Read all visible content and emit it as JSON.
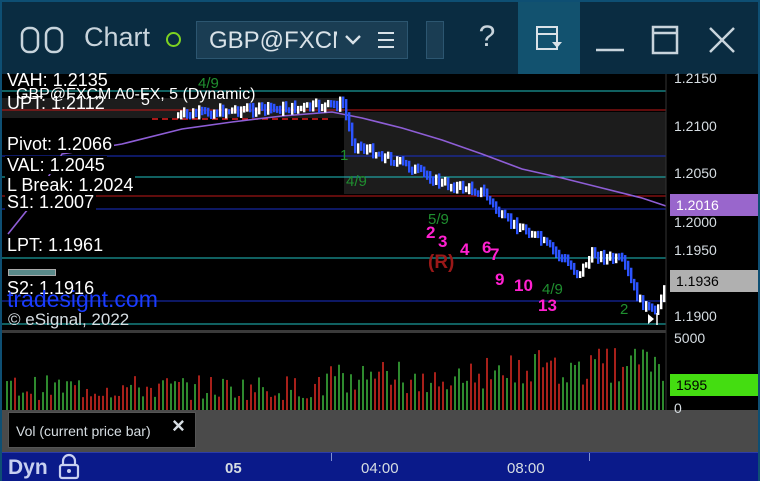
{
  "titlebar": {
    "title": "Chart",
    "symbol": "GBP@FXCM",
    "help": "?",
    "icons": [
      "layout-icon",
      "link-icon",
      "chevron-down-icon",
      "menu-icon",
      "dock-icon",
      "minimize-icon",
      "maximize-icon",
      "close-icon"
    ]
  },
  "chart": {
    "header": "GBP@FXCM A0-FX, 5 (Dynamic)",
    "labels": {
      "vah": "VAH: 1.2135",
      "upt": "UPT: 1.2112",
      "upt_extra": "5",
      "pivot": "Pivot: 1.2066",
      "val": "VAL: 1.2045",
      "lbreak": "L Break: 1.2024",
      "s1": "S1: 1.2007",
      "lpt": "LPT: 1.1961",
      "s2": "S2: 1.1916",
      "watermark": "tradesignt.com",
      "copyright": "© eSignal, 2022"
    },
    "annotations": {
      "r": "(R)",
      "numbers": [
        "2",
        "3",
        "4",
        "6",
        "7",
        "9",
        "10",
        "13"
      ]
    },
    "price_axis": [
      "1.2150",
      "1.2100",
      "1.2050",
      "1.2000",
      "1.1950",
      "1.1900"
    ],
    "tags": {
      "ma": "1.2016",
      "last": "1.1936",
      "volume": "1595"
    },
    "colors": {
      "price_bars": "#ffffff",
      "down_bars": "#2c54ff",
      "ma": "#8e5ed6",
      "ma_tag": "#9966cc",
      "last_tag": "#b0b0b0",
      "volume_tag": "#44dd11",
      "vol_up": "#2e8a2e",
      "vol_down": "#a8201a",
      "seq_numbers": "#ff20d0"
    }
  },
  "volume": {
    "axis": [
      "5000",
      "0"
    ],
    "label": "Vol (current price bar)",
    "close": "×"
  },
  "timebar": {
    "mode": "Dyn",
    "times": [
      "05",
      "04:00",
      "08:00"
    ]
  }
}
